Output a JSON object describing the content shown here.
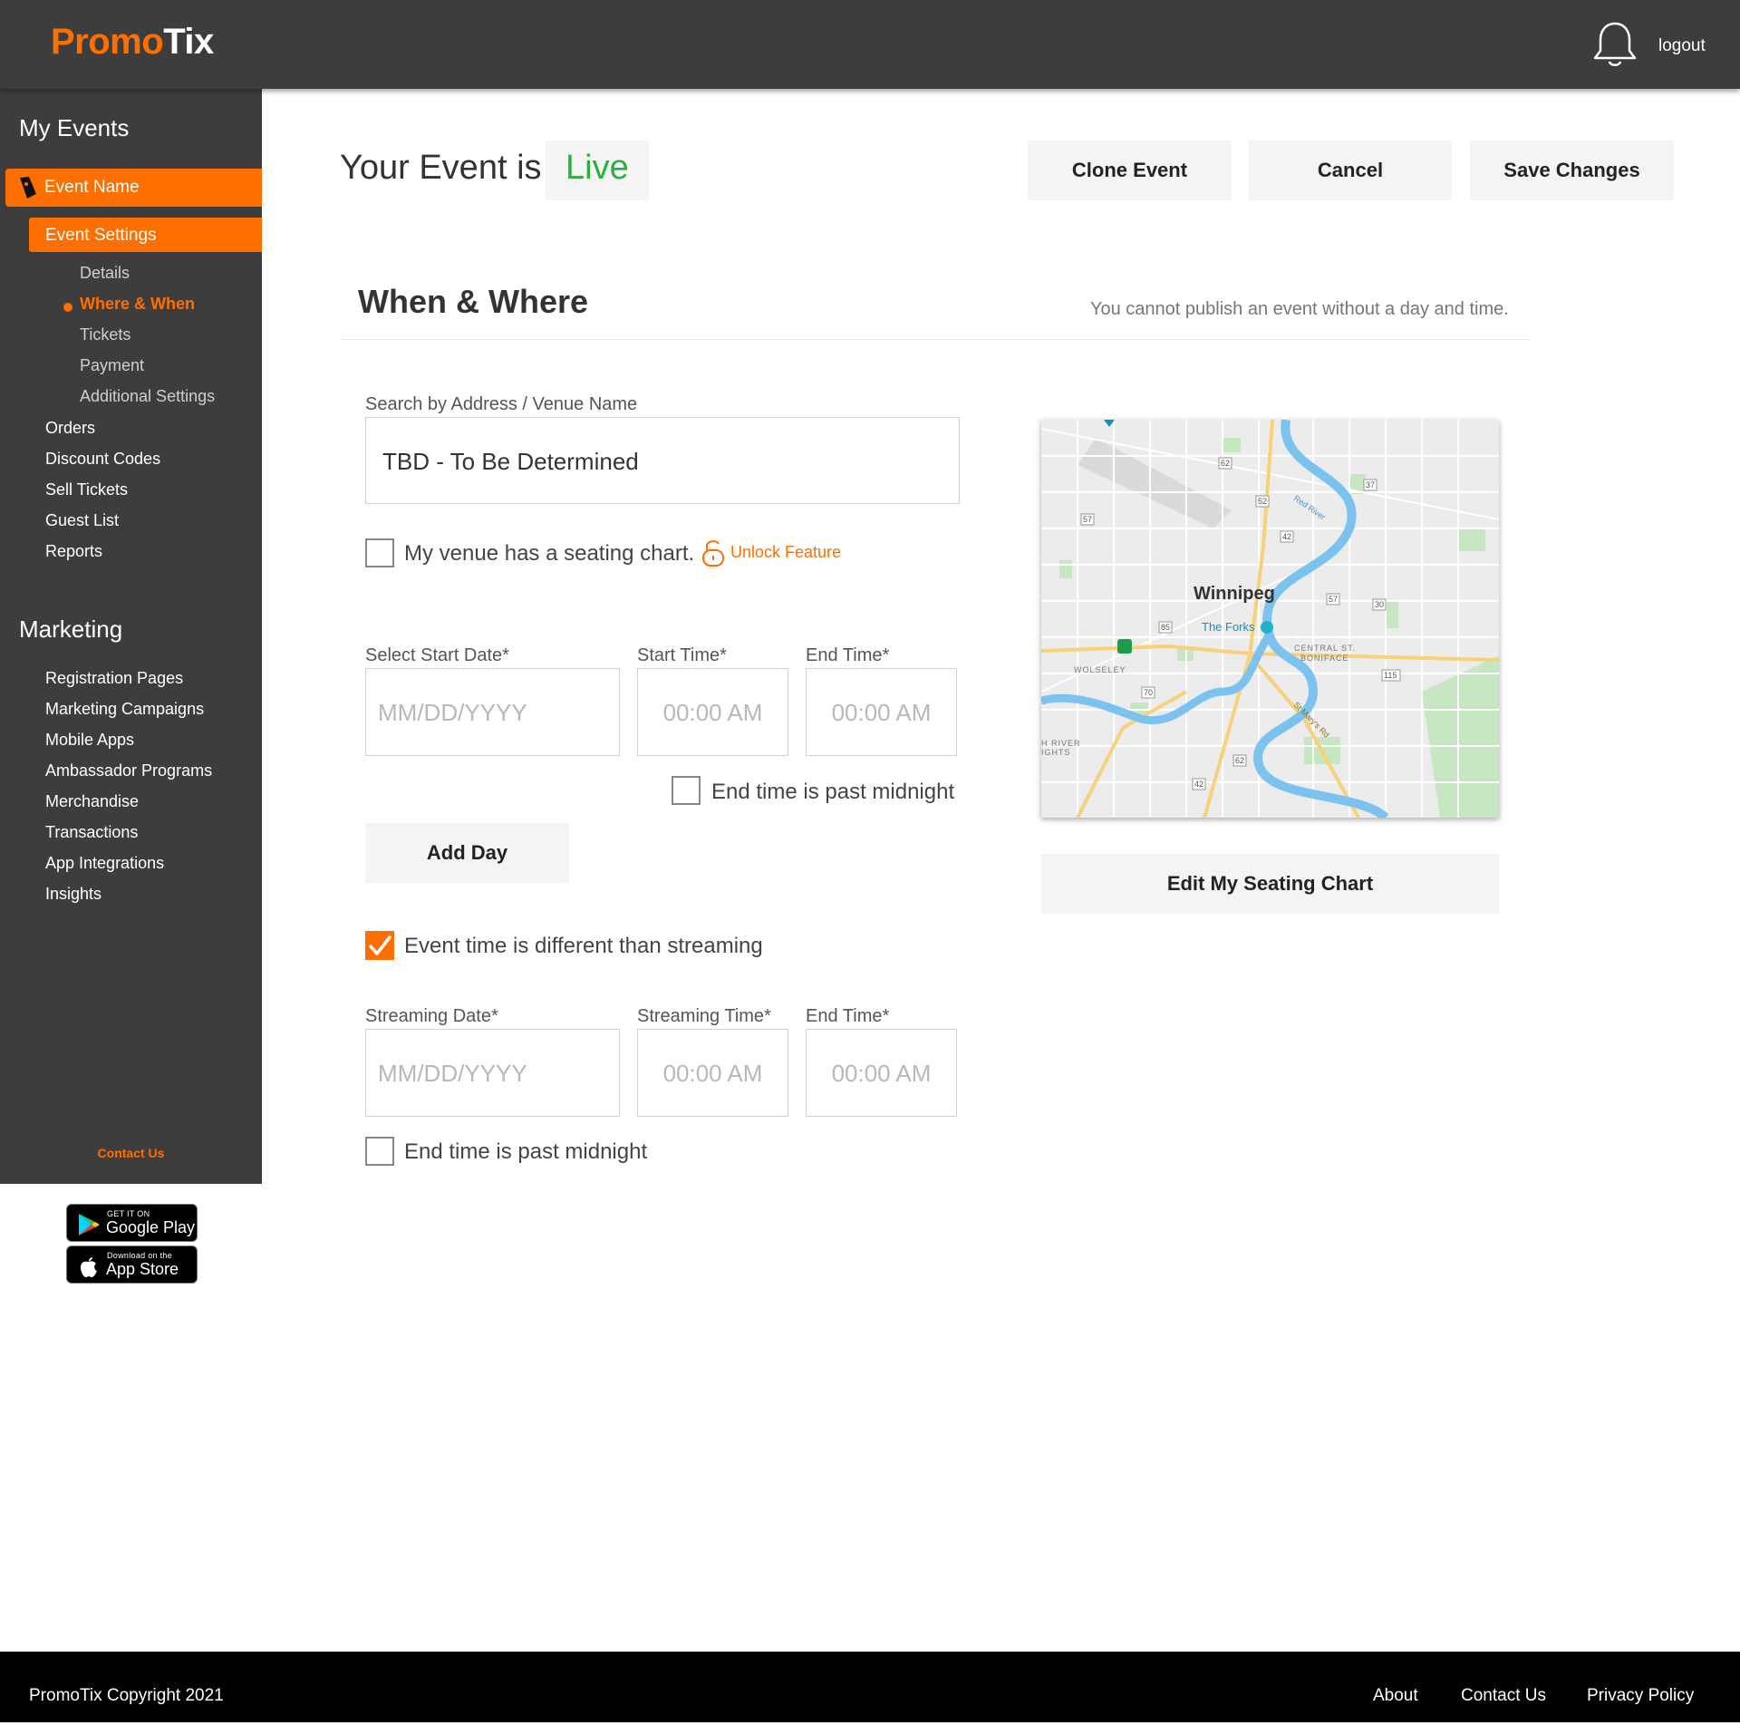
{
  "header": {
    "logo_part1": "Promo",
    "logo_part2": "Tix",
    "logout_label": "logout"
  },
  "sidebar": {
    "my_events_heading": "My Events",
    "event_name": "Event Name",
    "event_settings": "Event Settings",
    "settings_items": [
      "Details",
      "Where & When",
      "Tickets",
      "Payment",
      "Additional Settings"
    ],
    "active_settings_item": "Where & When",
    "event_items": [
      "Orders",
      "Discount Codes",
      "Sell Tickets",
      "Guest List",
      "Reports"
    ],
    "marketing_heading": "Marketing",
    "marketing_items": [
      "Registration Pages",
      "Marketing Campaigns",
      "Mobile Apps",
      "Ambassador Programs",
      "Merchandise",
      "Transactions",
      "App Integrations",
      "Insights"
    ],
    "contact_us": "Contact Us"
  },
  "stores": {
    "google_small": "GET IT ON",
    "google_big": "Google Play",
    "apple_small": "Download on the",
    "apple_big": "App Store"
  },
  "main": {
    "status_prefix": "Your Event is",
    "status_value": "Live",
    "clone_button": "Clone Event",
    "cancel_button": "Cancel",
    "save_button": "Save Changes",
    "section_title": "When & Where",
    "section_note": "You cannot publish an event without a day and time.",
    "venue_label": "Search by Address / Venue Name",
    "venue_value": "TBD - To Be Determined",
    "seating_checkbox_label": "My venue has a seating chart.",
    "seating_checked": false,
    "unlock_label": "Unlock Feature",
    "start_date_label": "Select Start Date*",
    "start_date_placeholder": "MM/DD/YYYY",
    "start_time_label": "Start Time*",
    "start_time_placeholder": "00:00 AM",
    "end_time_label": "End Time*",
    "end_time_placeholder": "00:00 AM",
    "past_midnight_label": "End time is past midnight",
    "add_day_button": "Add Day",
    "streaming_diff_label": "Event time is different than streaming",
    "streaming_diff_checked": true,
    "streaming_date_label": "Streaming Date*",
    "streaming_date_placeholder": "MM/DD/YYYY",
    "streaming_time_label": "Streaming Time*",
    "streaming_time_placeholder": "00:00 AM",
    "streaming_end_label": "End Time*",
    "streaming_end_placeholder": "00:00 AM",
    "streaming_past_midnight_label": "End time is past midnight",
    "edit_seating_button": "Edit My Seating Chart"
  },
  "map": {
    "city": "Winnipeg",
    "poi": "The Forks",
    "district1": "CENTRAL ST.",
    "district2": "BONIFACE",
    "district3": "WOLSELEY",
    "district4a": "H RIVER",
    "district4b": "IGHTS",
    "river_label": "Red River",
    "road_label": "St Mary's Rd",
    "route_numbers": [
      "62",
      "37",
      "52",
      "57",
      "42",
      "57",
      "30",
      "85",
      "115",
      "70",
      "62",
      "42"
    ]
  },
  "footer": {
    "copyright": "PromoTix Copyright 2021",
    "about": "About",
    "contact": "Contact Us",
    "privacy": "Privacy Policy"
  },
  "colors": {
    "brand_orange": "#ff6f00",
    "dark_bg": "#3d3d3d",
    "live_green": "#28b23a"
  }
}
